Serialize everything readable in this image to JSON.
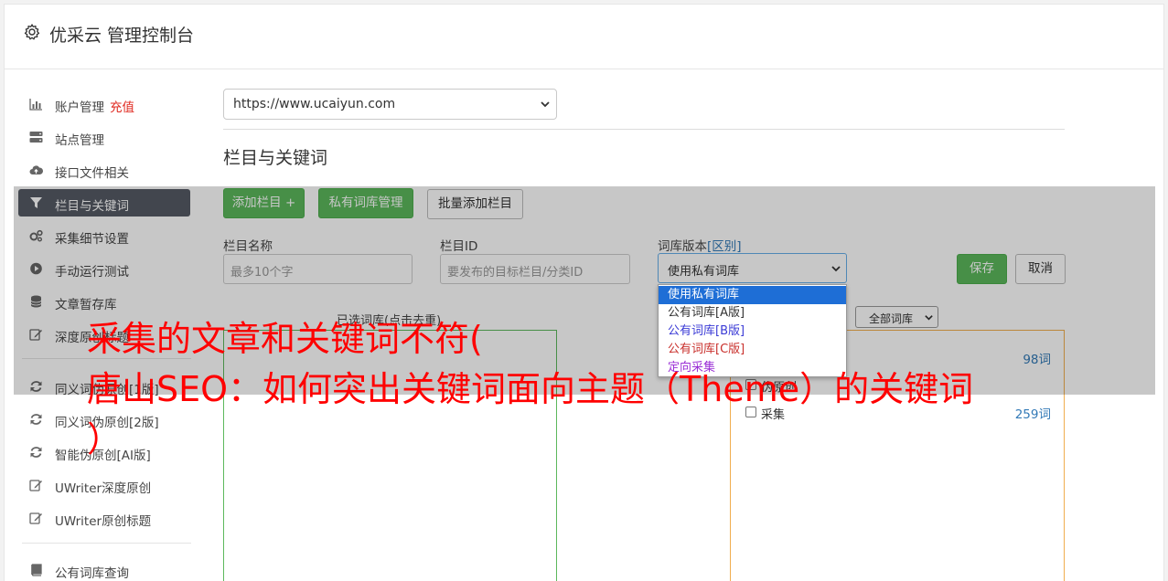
{
  "app": {
    "title": "优采云 管理控制台"
  },
  "sidebar": {
    "items": [
      {
        "label": "账户管理",
        "extra": "充值",
        "icon": "bar-chart-icon"
      },
      {
        "label": "站点管理",
        "icon": "server-icon"
      },
      {
        "label": "接口文件相关",
        "icon": "cloud-upload-icon"
      },
      {
        "label": "栏目与关键词",
        "icon": "filter-icon"
      },
      {
        "label": "采集细节设置",
        "icon": "cogs-icon"
      },
      {
        "label": "手动运行测试",
        "icon": "play-circle-icon"
      },
      {
        "label": "文章暂存库",
        "icon": "database-icon"
      },
      {
        "label": "深度原创标题",
        "icon": "edit-icon"
      },
      {
        "label": "同义词伪原创[1版]",
        "icon": "refresh-icon"
      },
      {
        "label": "同义词伪原创[2版]",
        "icon": "refresh-icon"
      },
      {
        "label": "智能伪原创[AI版]",
        "icon": "refresh-icon"
      },
      {
        "label": "UWriter深度原创",
        "icon": "edit-icon"
      },
      {
        "label": "UWriter原创标题",
        "icon": "edit-icon"
      },
      {
        "label": "公有词库查询",
        "icon": "book-icon"
      }
    ]
  },
  "main": {
    "site_select_value": "https://www.ucaiyun.com",
    "section_title": "栏目与关键词",
    "buttons": {
      "add_column": "添加栏目 +",
      "private_lib": "私有词库管理",
      "batch_add": "批量添加栏目",
      "save": "保存",
      "cancel": "取消"
    },
    "fields": {
      "column_name_label": "栏目名称",
      "column_name_placeholder": "最多10个字",
      "column_id_label": "栏目ID",
      "column_id_placeholder": "要发布的目标栏目/分类ID",
      "lib_version_label": "词库版本",
      "lib_version_link": "[区别]",
      "lib_version_value": "使用私有词库"
    },
    "dropdown_options": [
      "使用私有词库",
      "公有词库[A版]",
      "公有词库[B版]",
      "公有词库[C版]",
      "定向采集"
    ],
    "selected_words_label": "已选词库(点击去重)",
    "all_libs_select": "全部词库",
    "word_libs": [
      {
        "name": "",
        "count": "98词"
      },
      {
        "name": "伪原创",
        "count": ""
      },
      {
        "name": "采集",
        "count": "259词"
      }
    ]
  },
  "headline": {
    "line1": "采集的文章和关键词不符(",
    "line2": "唐山SEO：如何突出关键词面向主题（Theme）的关键词",
    "line3": "）"
  },
  "colors": {
    "green": "#5cb85c",
    "orange": "#f0ad4e",
    "active_nav": "#555a64",
    "headline": "#ff0000",
    "recharge": "#e0281f"
  }
}
